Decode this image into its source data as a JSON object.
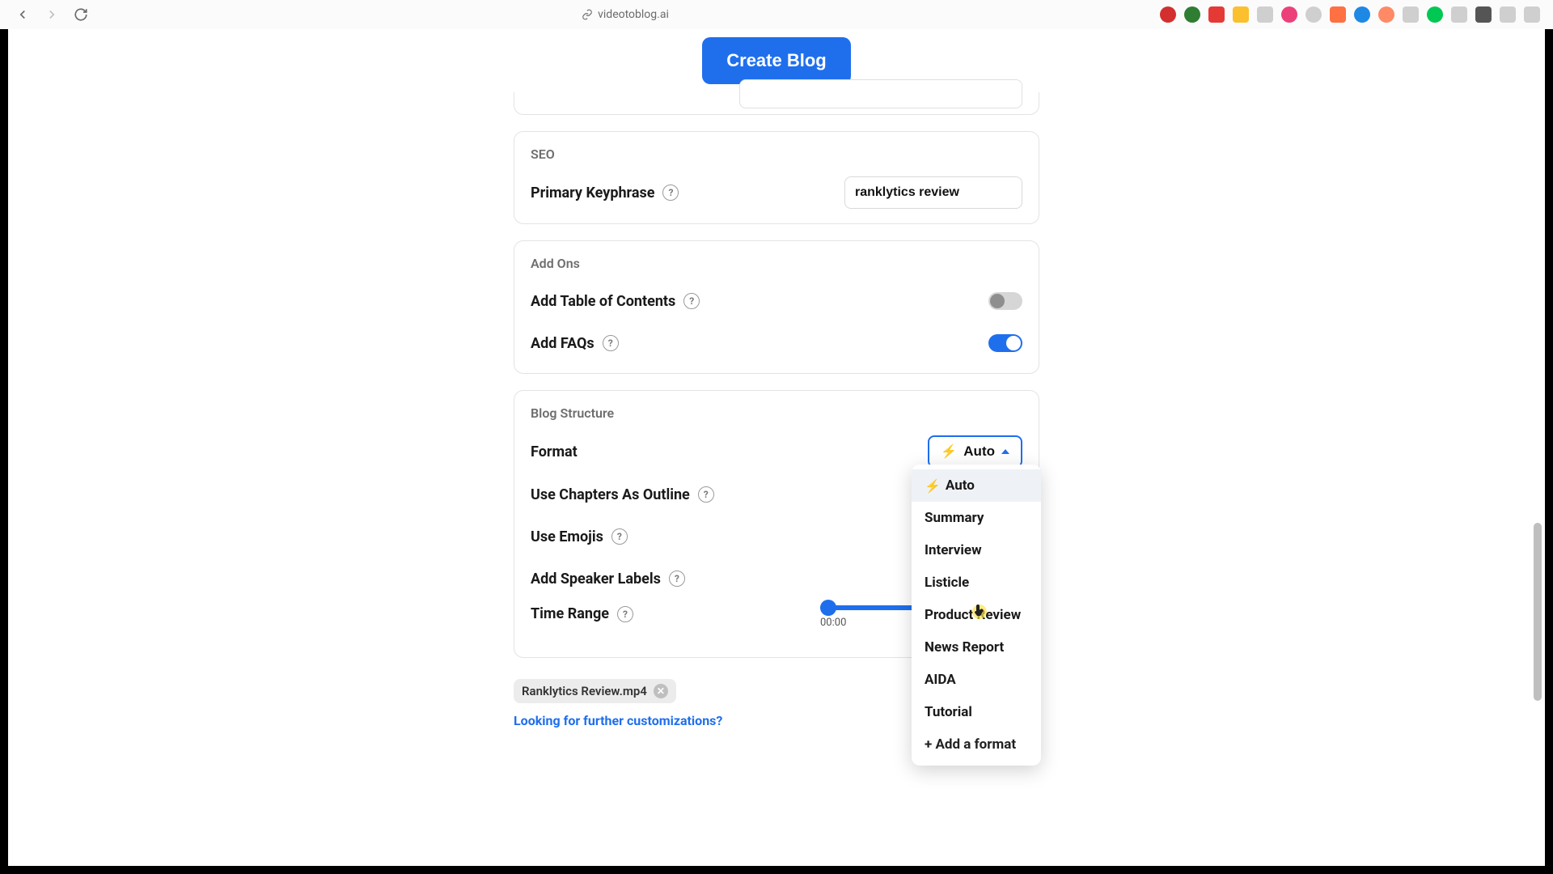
{
  "browser": {
    "url": "videotoblog.ai"
  },
  "header": {
    "create_button": "Create Blog"
  },
  "seo": {
    "title": "SEO",
    "primary_keyphrase_label": "Primary Keyphrase",
    "primary_keyphrase_value": "ranklytics review"
  },
  "addons": {
    "title": "Add Ons",
    "toc_label": "Add Table of Contents",
    "toc_enabled": false,
    "faqs_label": "Add FAQs",
    "faqs_enabled": true
  },
  "structure": {
    "title": "Blog Structure",
    "format_label": "Format",
    "format_selected": "Auto",
    "dropdown_options": [
      "Auto",
      "Summary",
      "Interview",
      "Listicle",
      "Product Review",
      "News Report",
      "AIDA",
      "Tutorial"
    ],
    "dropdown_add": "+ Add a format",
    "chapters_label": "Use Chapters As Outline",
    "emojis_label": "Use Emojis",
    "speaker_label": "Add Speaker Labels",
    "time_range_label": "Time Range",
    "time_range_start": "00:00"
  },
  "footer": {
    "chip_label": "Ranklytics Review.mp4",
    "customizations_link": "Looking for further customizations?"
  },
  "colors": {
    "primary": "#1f6fed",
    "accent": "#f5b400"
  }
}
